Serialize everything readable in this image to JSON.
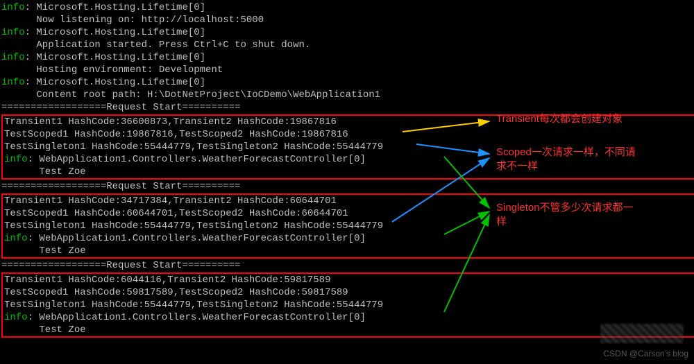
{
  "header": [
    {
      "prefix": "info",
      "text": ": Microsoft.Hosting.Lifetime[0]"
    },
    {
      "prefix": "",
      "text": "      Now listening on: http://localhost:5000"
    },
    {
      "prefix": "info",
      "text": ": Microsoft.Hosting.Lifetime[0]"
    },
    {
      "prefix": "",
      "text": "      Application started. Press Ctrl+C to shut down."
    },
    {
      "prefix": "info",
      "text": ": Microsoft.Hosting.Lifetime[0]"
    },
    {
      "prefix": "",
      "text": "      Hosting environment: Development"
    },
    {
      "prefix": "info",
      "text": ": Microsoft.Hosting.Lifetime[0]"
    },
    {
      "prefix": "",
      "text": "      Content root path: H:\\DotNetProject\\IoCDemo\\WebApplication1"
    }
  ],
  "separator": "==================Request Start==========",
  "requests": [
    {
      "transient": "Transient1 HashCode:36600873,Transient2 HashCode:19867816",
      "scoped": "TestScoped1 HashCode:19867816,TestScoped2 HashCode:19867816",
      "singleton": "TestSingleton1 HashCode:55444779,TestSingleton2 HashCode:55444779",
      "logPrefix": "info",
      "logText": ": WebApplication1.Controllers.WeatherForecastController[0]",
      "tail": "      Test Zoe"
    },
    {
      "transient": "Transient1 HashCode:34717384,Transient2 HashCode:60644701",
      "scoped": "TestScoped1 HashCode:60644701,TestScoped2 HashCode:60644701",
      "singleton": "TestSingleton1 HashCode:55444779,TestSingleton2 HashCode:55444779",
      "logPrefix": "info",
      "logText": ": WebApplication1.Controllers.WeatherForecastController[0]",
      "tail": "      Test Zoe"
    },
    {
      "transient": "Transient1 HashCode:6044116,Transient2 HashCode:59817589",
      "scoped": "TestScoped1 HashCode:59817589,TestScoped2 HashCode:59817589",
      "singleton": "TestSingleton1 HashCode:55444779,TestSingleton2 HashCode:55444779",
      "logPrefix": "info",
      "logText": ": WebApplication1.Controllers.WeatherForecastController[0]",
      "tail": "      Test Zoe"
    }
  ],
  "annotations": {
    "transient": "Transient每次都会创建对象",
    "scoped_l1": "Scoped一次请求一样，不同请",
    "scoped_l2": "求不一样",
    "singleton_l1": "Singleton不管多少次请求都一",
    "singleton_l2": "样"
  },
  "watermark": "CSDN @Carson's  blog"
}
